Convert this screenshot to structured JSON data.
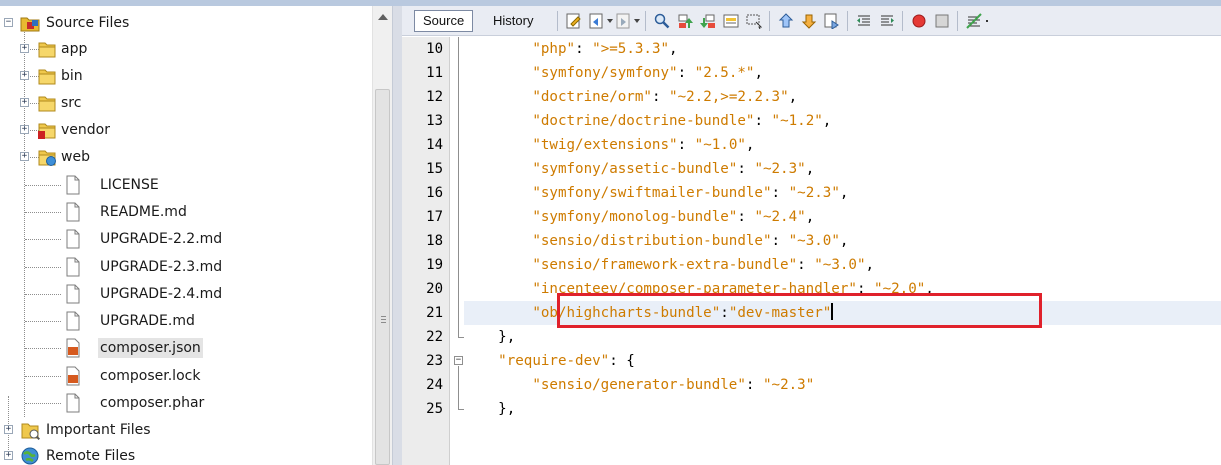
{
  "project_tree": {
    "root": {
      "label": "Source Files",
      "icon": "source-files-folder-icon"
    },
    "folders": [
      {
        "label": "app",
        "icon": "folder-icon"
      },
      {
        "label": "bin",
        "icon": "folder-icon"
      },
      {
        "label": "src",
        "icon": "folder-icon"
      },
      {
        "label": "vendor",
        "icon": "folder-error-icon"
      },
      {
        "label": "web",
        "icon": "web-folder-icon"
      }
    ],
    "files": [
      {
        "label": "LICENSE",
        "icon": "file-icon"
      },
      {
        "label": "README.md",
        "icon": "file-icon"
      },
      {
        "label": "UPGRADE-2.2.md",
        "icon": "file-icon"
      },
      {
        "label": "UPGRADE-2.3.md",
        "icon": "file-icon"
      },
      {
        "label": "UPGRADE-2.4.md",
        "icon": "file-icon"
      },
      {
        "label": "UPGRADE.md",
        "icon": "file-icon"
      },
      {
        "label": "composer.json",
        "icon": "json-file-icon",
        "selected": true
      },
      {
        "label": "composer.lock",
        "icon": "json-file-icon"
      },
      {
        "label": "composer.phar",
        "icon": "file-icon"
      }
    ],
    "bottom_nodes": [
      {
        "label": "Important Files",
        "icon": "important-files-icon"
      },
      {
        "label": "Remote Files",
        "icon": "globe-icon"
      }
    ]
  },
  "editor_toolbar": {
    "source_tab": "Source",
    "history_tab": "History",
    "icons": [
      "last-edit-icon",
      "back-icon",
      "forward-icon",
      "find-icon",
      "find-previous-icon",
      "find-next-icon",
      "toggle-highlight-icon",
      "select-rect-icon",
      "previous-bookmark-icon",
      "next-bookmark-icon",
      "toggle-bookmark-icon",
      "shift-left-icon",
      "shift-right-icon",
      "start-macro-icon",
      "stop-macro-icon",
      "comment-icon"
    ]
  },
  "editor": {
    "line_numbers": [
      "10",
      "11",
      "12",
      "13",
      "14",
      "15",
      "16",
      "17",
      "18",
      "19",
      "20",
      "21",
      "22",
      "23",
      "24",
      "25"
    ],
    "lines": [
      {
        "indent": "        ",
        "key": "\"php\"",
        "sep": ": ",
        "value": "\">=5.3.3\"",
        "tail": ","
      },
      {
        "indent": "        ",
        "key": "\"symfony/symfony\"",
        "sep": ": ",
        "value": "\"2.5.*\"",
        "tail": ","
      },
      {
        "indent": "        ",
        "key": "\"doctrine/orm\"",
        "sep": ": ",
        "value": "\"~2.2,>=2.2.3\"",
        "tail": ","
      },
      {
        "indent": "        ",
        "key": "\"doctrine/doctrine-bundle\"",
        "sep": ": ",
        "value": "\"~1.2\"",
        "tail": ","
      },
      {
        "indent": "        ",
        "key": "\"twig/extensions\"",
        "sep": ": ",
        "value": "\"~1.0\"",
        "tail": ","
      },
      {
        "indent": "        ",
        "key": "\"symfony/assetic-bundle\"",
        "sep": ": ",
        "value": "\"~2.3\"",
        "tail": ","
      },
      {
        "indent": "        ",
        "key": "\"symfony/swiftmailer-bundle\"",
        "sep": ": ",
        "value": "\"~2.3\"",
        "tail": ","
      },
      {
        "indent": "        ",
        "key": "\"symfony/monolog-bundle\"",
        "sep": ": ",
        "value": "\"~2.4\"",
        "tail": ","
      },
      {
        "indent": "        ",
        "key": "\"sensio/distribution-bundle\"",
        "sep": ": ",
        "value": "\"~3.0\"",
        "tail": ","
      },
      {
        "indent": "        ",
        "key": "\"sensio/framework-extra-bundle\"",
        "sep": ": ",
        "value": "\"~3.0\"",
        "tail": ","
      },
      {
        "indent": "        ",
        "key": "\"incenteev/composer-parameter-handler\"",
        "sep": ": ",
        "value": "\"~2.0\"",
        "tail": ","
      },
      {
        "indent": "        ",
        "key": "\"ob/highcharts-bundle\"",
        "sep": ":",
        "value": "\"dev-master\"",
        "tail": ""
      },
      {
        "indent": "    ",
        "key": "",
        "sep": "},",
        "value": "",
        "tail": ""
      },
      {
        "indent": "    ",
        "key": "\"require-dev\"",
        "sep": ": {",
        "value": "",
        "tail": ""
      },
      {
        "indent": "        ",
        "key": "\"sensio/generator-bundle\"",
        "sep": ": ",
        "value": "\"~2.3\"",
        "tail": ""
      },
      {
        "indent": "    ",
        "key": "",
        "sep": "},",
        "value": "",
        "tail": ""
      }
    ],
    "current_line_index": 11
  },
  "colors": {
    "string": "#ce7b00",
    "highlight_box": "#e0212b",
    "current_line": "#e9eff8"
  }
}
